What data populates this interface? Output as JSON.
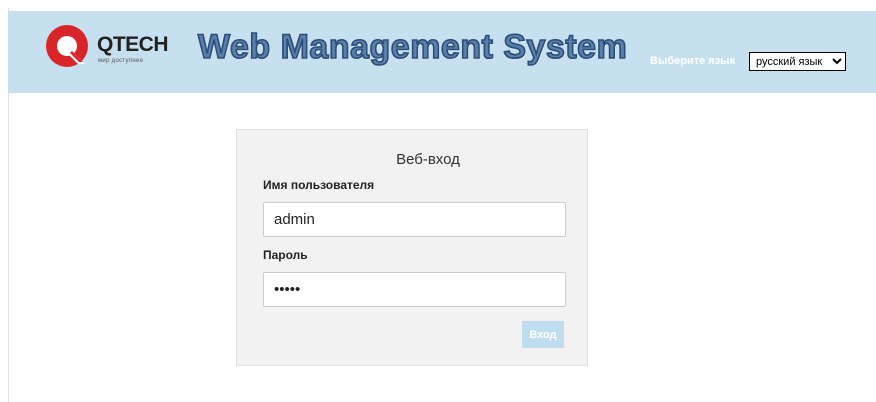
{
  "header": {
    "logo_brand": "QTECH",
    "logo_tagline": "мир доступнее",
    "app_title": "Web Management System",
    "language_label": "Выберите язык",
    "language_selected": "русский язык",
    "background_color": "#c6e0ef",
    "logo_color": "#d9252a"
  },
  "login": {
    "title": "Веб-вход",
    "username_label": "Имя пользователя",
    "username_value": "admin",
    "password_label": "Пароль",
    "password_value": "admin",
    "submit_label": "Вход",
    "submit_color": "#c0ddef"
  }
}
